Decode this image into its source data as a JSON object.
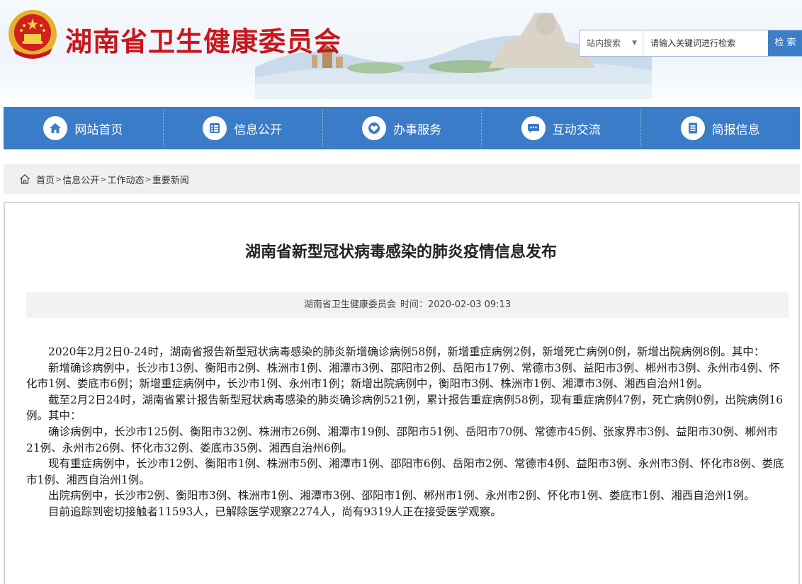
{
  "header": {
    "site_title": "湖南省卫生健康委员会",
    "search": {
      "scope_label": "站内搜索",
      "placeholder": "请输入关键词进行检索",
      "button_label": "检 索"
    }
  },
  "nav": {
    "items": [
      {
        "label": "网站首页",
        "icon": "home-icon"
      },
      {
        "label": "信息公开",
        "icon": "info-list-icon"
      },
      {
        "label": "办事服务",
        "icon": "service-icon"
      },
      {
        "label": "互动交流",
        "icon": "chat-icon"
      },
      {
        "label": "简报信息",
        "icon": "document-icon"
      }
    ]
  },
  "breadcrumb": {
    "items": [
      "首页",
      "信息公开",
      "工作动态",
      "重要新闻"
    ],
    "separator": ">"
  },
  "article": {
    "title": "湖南省新型冠状病毒感染的肺炎疫情信息发布",
    "source": "湖南省卫生健康委员会",
    "time_label": "时间：",
    "time": "2020-02-03 09:13",
    "paragraphs": [
      "2020年2月2日0-24时，湖南省报告新型冠状病毒感染的肺炎新增确诊病例58例，新增重症病例2例，新增死亡病例0例，新增出院病例8例。其中：",
      "新增确诊病例中，长沙市13例、衡阳市2例、株洲市1例、湘潭市3例、邵阳市2例、岳阳市17例、常德市3例、益阳市3例、郴州市3例、永州市4例、怀化市1例、娄底市6例；新增重症病例中，长沙市1例、永州市1例；新增出院病例中，衡阳市3例、株洲市1例、湘潭市3例、湘西自治州1例。",
      "截至2月2日24时，湖南省累计报告新型冠状病毒感染的肺炎确诊病例521例，累计报告重症病例58例，现有重症病例47例，死亡病例0例，出院病例16例。其中：",
      "确诊病例中，长沙市125例、衡阳市32例、株洲市26例、湘潭市19例、邵阳市51例、岳阳市70例、常德市45例、张家界市3例、益阳市30例、郴州市21例、永州市26例、怀化市32例、娄底市35例、湘西自治州6例。",
      "现有重症病例中，长沙市12例、衡阳市1例、株洲市5例、湘潭市1例、邵阳市6例、岳阳市2例、常德市4例、益阳市3例、永州市3例、怀化市8例、娄底市1例、湘西自治州1例。",
      "出院病例中，长沙市2例、衡阳市3例、株洲市1例、湘潭市3例、邵阳市1例、郴州市1例、永州市2例、怀化市1例、娄底市1例、湘西自治州1例。",
      "目前追踪到密切接触者11593人，已解除医学观察2274人，尚有9319人正在接受医学观察。"
    ]
  },
  "colors": {
    "brand_red": "#c8161d",
    "nav_blue": "#3b7cc8",
    "search_button": "#3d7ec6"
  }
}
